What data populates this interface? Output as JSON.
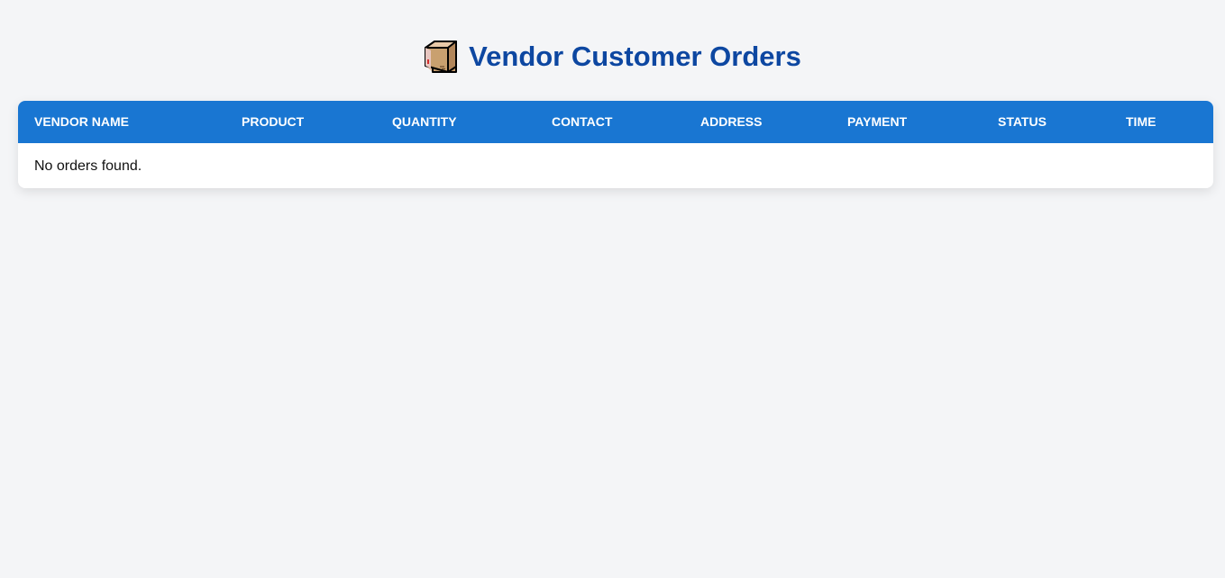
{
  "header": {
    "icon": "package-box-icon",
    "title": "Vendor Customer Orders"
  },
  "table": {
    "columns": [
      "VENDOR NAME",
      "PRODUCT",
      "QUANTITY",
      "CONTACT",
      "ADDRESS",
      "PAYMENT",
      "STATUS",
      "TIME"
    ],
    "rows": [],
    "empty_message": "No orders found."
  },
  "colors": {
    "page_background": "#f4f5f7",
    "title": "#0d47a1",
    "header_background": "#1976d2",
    "header_text": "#ffffff",
    "body_text": "#111111"
  }
}
